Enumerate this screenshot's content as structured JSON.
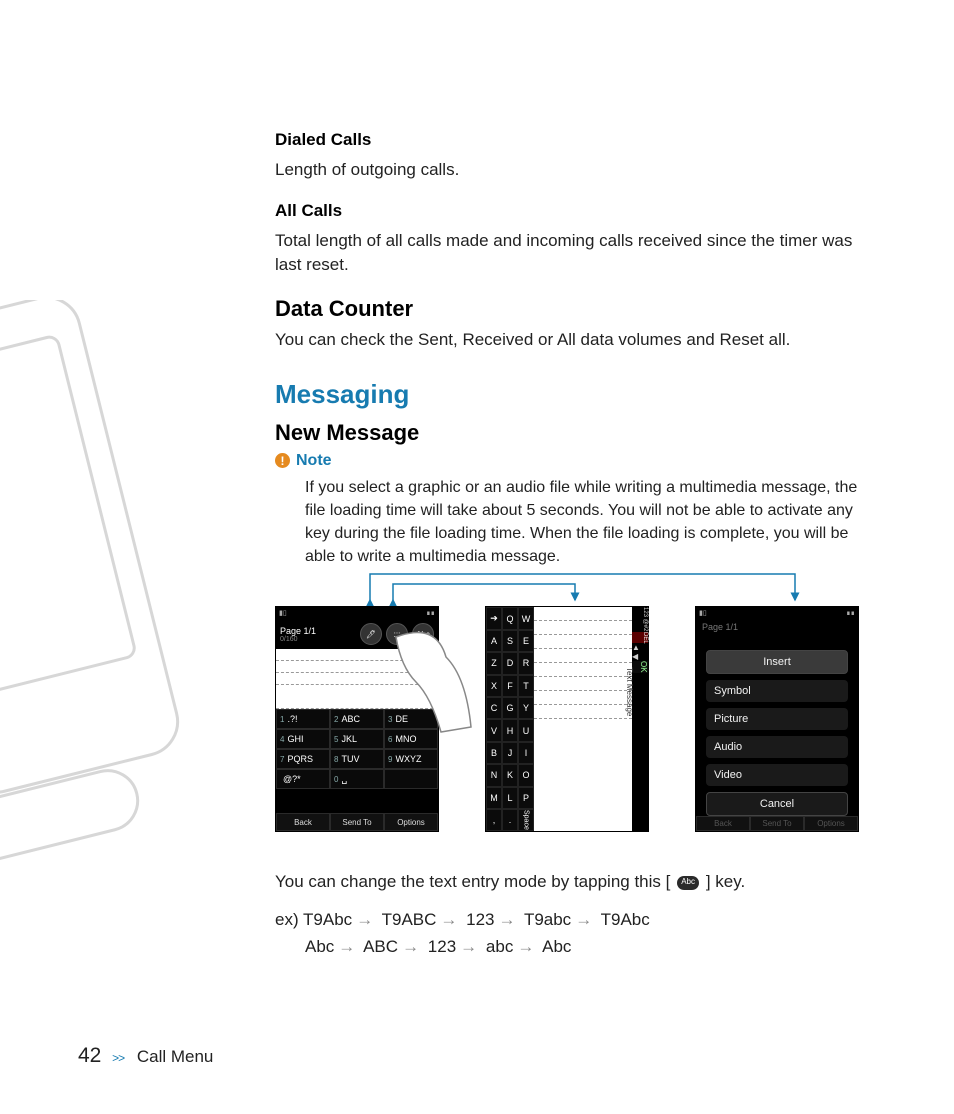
{
  "sections": {
    "dialed_calls_h": "Dialed Calls",
    "dialed_calls_body": "Length of outgoing calls.",
    "all_calls_h": "All Calls",
    "all_calls_body": "Total length of all calls made and incoming calls received since the timer was last reset.",
    "data_counter_h": "Data Counter",
    "data_counter_body": "You can check the Sent, Received or All data volumes and Reset all.",
    "messaging_h": "Messaging",
    "new_message_h": "New Message",
    "note_label": "Note",
    "note_body": "If you select a graphic or an audio file while writing a multimedia message, the file loading time will take about 5 seconds. You will not be able to activate any key during the file loading time. When the file loading is complete, you will be able to write a multimedia message.",
    "after_text_1a": "You can change the text entry mode by tapping this [",
    "after_text_1b": "] key.",
    "inline_key_label": "Abc",
    "ex_prefix": "ex)",
    "ex_line1": [
      "T9Abc",
      "T9ABC",
      "123",
      "T9abc",
      "T9Abc"
    ],
    "ex_line2": [
      "Abc",
      "ABC",
      "123",
      "abc",
      "Abc"
    ]
  },
  "screens": {
    "s1": {
      "page_label": "Page 1/1",
      "counter": "0/160",
      "mode_buttons": [
        "🖊",
        ":::",
        "Abc"
      ],
      "keypad": [
        {
          "n": "1",
          "t": ".?!"
        },
        {
          "n": "2",
          "t": "ABC"
        },
        {
          "n": "3",
          "t": "DE"
        },
        {
          "n": "4",
          "t": "GHI"
        },
        {
          "n": "5",
          "t": "JKL"
        },
        {
          "n": "6",
          "t": "MNO"
        },
        {
          "n": "7",
          "t": "PQRS"
        },
        {
          "n": "8",
          "t": "TUV"
        },
        {
          "n": "9",
          "t": "WXYZ"
        },
        {
          "n": "",
          "t": "@?*"
        },
        {
          "n": "0",
          "t": "␣"
        },
        {
          "n": "",
          "t": ""
        }
      ],
      "softkeys": [
        "Back",
        "Send To",
        "Options"
      ]
    },
    "s2": {
      "left_cols": [
        [
          "➔",
          "A",
          "Z",
          "X",
          "C",
          "V",
          "B",
          "N",
          "M",
          ","
        ],
        [
          "Q",
          "S",
          "D",
          "F",
          "G",
          "H",
          "J",
          "K",
          "L",
          "."
        ],
        [
          "W",
          "E",
          "R",
          "T",
          "Y",
          "U",
          "I",
          "O",
          "P"
        ]
      ],
      "space": "Space",
      "side_label": "Text Message",
      "right_col_top": "123 @#2",
      "right_del": "DEL",
      "right_ok": "OK"
    },
    "s3": {
      "page_label": "Page 1/1",
      "menu": [
        "Insert",
        "Symbol",
        "Picture",
        "Audio",
        "Video",
        "Cancel"
      ],
      "softkeys": [
        "Back",
        "Send To",
        "Options"
      ]
    }
  },
  "footer": {
    "page": "42",
    "chev": ">>",
    "section": "Call Menu"
  }
}
